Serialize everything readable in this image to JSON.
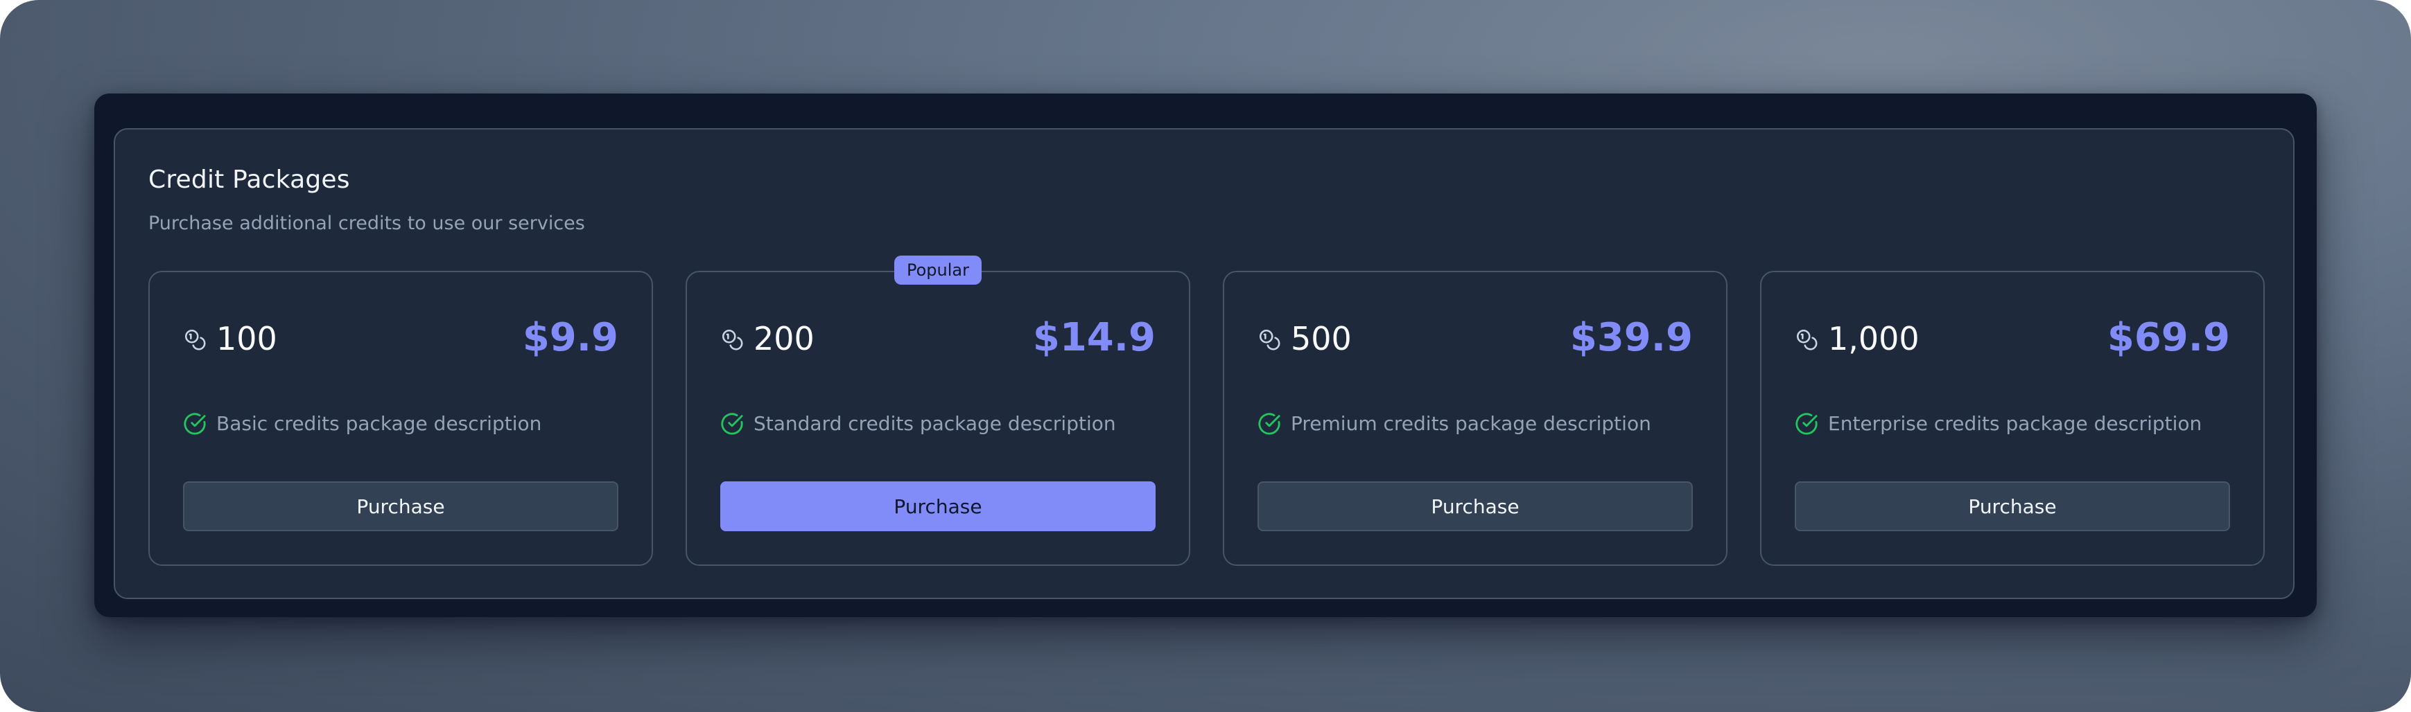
{
  "header": {
    "title": "Credit Packages",
    "subtitle": "Purchase additional credits to use our services"
  },
  "packages": [
    {
      "credits": "100",
      "price": "$9.9",
      "description": "Basic credits package description",
      "button_label": "Purchase",
      "badge": "",
      "primary": false
    },
    {
      "credits": "200",
      "price": "$14.9",
      "description": "Standard credits package description",
      "button_label": "Purchase",
      "badge": "Popular",
      "primary": true
    },
    {
      "credits": "500",
      "price": "$39.9",
      "description": "Premium credits package description",
      "button_label": "Purchase",
      "badge": "",
      "primary": false
    },
    {
      "credits": "1,000",
      "price": "$69.9",
      "description": "Enterprise credits package description",
      "button_label": "Purchase",
      "badge": "",
      "primary": false
    }
  ],
  "icons": {
    "credits": "coins-icon",
    "feature": "check-circle-icon"
  },
  "colors": {
    "accent": "#818cf8",
    "success": "#22c55e",
    "background": "#0f172a",
    "card": "#1e293b"
  }
}
